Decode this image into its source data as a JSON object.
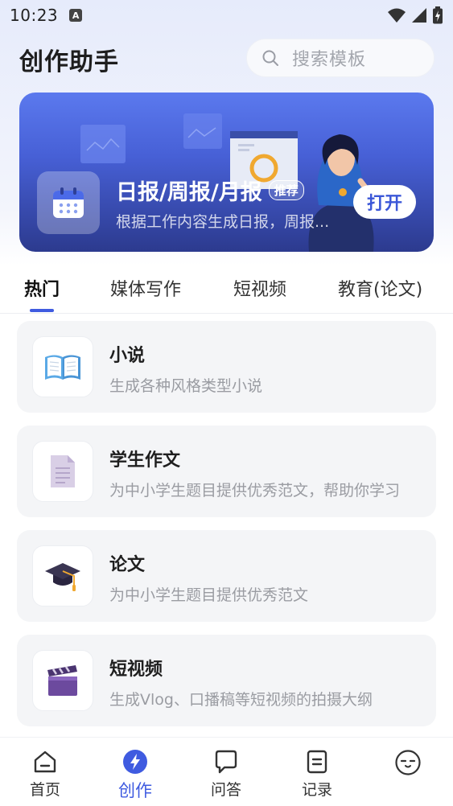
{
  "status_bar": {
    "time": "10:23",
    "notification_icon": "A"
  },
  "header": {
    "title": "创作助手",
    "search_placeholder": "搜索模板"
  },
  "banner": {
    "title": "日报/周报/月报",
    "badge": "推荐",
    "subtitle": "根据工作内容生成日报，周报...",
    "open_label": "打开"
  },
  "tabs": [
    {
      "label": "热门",
      "active": true
    },
    {
      "label": "媒体写作",
      "active": false
    },
    {
      "label": "短视频",
      "active": false
    },
    {
      "label": "教育(论文)",
      "active": false
    }
  ],
  "templates": [
    {
      "title": "小说",
      "description": "生成各种风格类型小说",
      "icon": "book-icon"
    },
    {
      "title": "学生作文",
      "description": "为中小学生题目提供优秀范文，帮助你学习",
      "icon": "document-icon"
    },
    {
      "title": "论文",
      "description": "为中小学生题目提供优秀范文",
      "icon": "graduation-cap-icon"
    },
    {
      "title": "短视频",
      "description": "生成Vlog、口播稿等短视频的拍摄大纲",
      "icon": "clapperboard-icon"
    }
  ],
  "bottom_nav": [
    {
      "label": "首页",
      "icon": "home-icon",
      "active": false
    },
    {
      "label": "创作",
      "icon": "lightning-icon",
      "active": true
    },
    {
      "label": "问答",
      "icon": "chat-bubble-icon",
      "active": false
    },
    {
      "label": "记录",
      "icon": "record-icon",
      "active": false
    },
    {
      "label": "",
      "icon": "profile-face-icon",
      "active": false
    }
  ],
  "colors": {
    "accent": "#3f5be0",
    "banner_top": "#5b79ee",
    "banner_bottom": "#2c3a8e",
    "card_bg": "#f4f5f7"
  }
}
